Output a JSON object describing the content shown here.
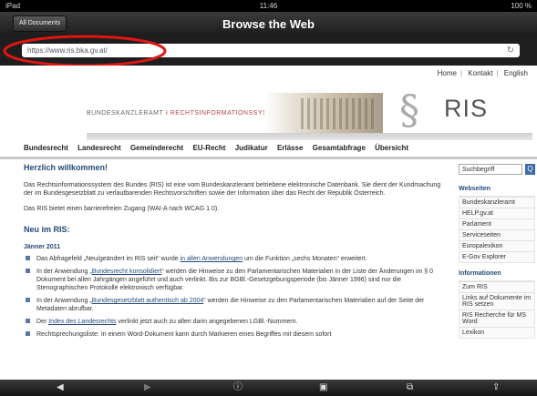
{
  "statusbar": {
    "left": "iPad",
    "time": "11:46",
    "battery": "100 %"
  },
  "navbar": {
    "back_label": "All Documents",
    "title": "Browse the Web"
  },
  "url": {
    "value": "https://www.ris.bka.gv.at/"
  },
  "top_links": [
    "Home",
    "Kontakt",
    "English"
  ],
  "banner": {
    "left_text": "BUNDESKANZLERAMT",
    "right_text": "RECHTSINFORMATIONSSYSTEM",
    "logo": "RIS",
    "symbol": "§"
  },
  "main_nav": [
    "Bundesrecht",
    "Landesrecht",
    "Gemeinderecht",
    "EU-Recht",
    "Judikatur",
    "Erlässe",
    "Gesamtabfrage",
    "Übersicht"
  ],
  "content": {
    "welcome_title": "Herzlich willkommen!",
    "welcome_p1": "Das Rechtsinformationssystem des Bundes (RIS) ist eine vom Bundeskanzleramt betriebene elektronische Datenbank. Sie dient der Kundmachung der im Bundesgesetzblatt zu verlautbarenden Rechtsvorschriften sowie der Information über das Recht der Republik Österreich.",
    "welcome_p2": "Das RIS bietet einen barrierefreien Zugang (WAI-A nach WCAG 1.0).",
    "news_title": "Neu im RIS:",
    "news_date": "Jänner 2011",
    "news": [
      {
        "text": "Das Abfragefeld „Neu/geändert im RIS seit“ wurde ",
        "link": "in allen Anwendungen",
        "rest": " um die Funktion „sechs Monaten“ erweitert."
      },
      {
        "text": "In der Anwendung „",
        "link": "Bundesrecht konsolidiert",
        "rest": "“ werden die Hinweise zu den Parlamentarischen Materialien in der Liste der Änderungen im § 0 Dokument bei allen Jahrgängen angeführt und auch verlinkt. Bis zur BGBl.-Gesetzgebungsperiode (bis Jänner 1996) sind nur die Stenographischen Protokolle elektronisch verfügbar."
      },
      {
        "text": "In der Anwendung „",
        "link": "Bundesgesetzblatt authentisch ab 2004",
        "rest": "“ werden die Hinweise zu den Parlamentarischen Materialien auf der Seite der Metadaten abrufbar."
      },
      {
        "text": "Der ",
        "link": "Index des Landesrechts",
        "rest": " verlinkt jetzt auch zu allen darin angegebenen LGBl.-Nummern."
      },
      {
        "text": "Rechtsprechungsliste: In einem Word-Dokument kann durch Markieren eines Begriffes mit diesem sofort",
        "link": "",
        "rest": ""
      }
    ]
  },
  "sidebar": {
    "search_placeholder": "Suchbegriff",
    "search_button": "Q",
    "websites_title": "Webseiten",
    "websites": [
      "Bundeskanzleramt",
      "HELP.gv.at",
      "Parlament",
      "Serviceseiten",
      "Europalexikon",
      "E-Gov Explorer"
    ],
    "info_title": "Informationen",
    "info": [
      "Zum RIS",
      "Links auf Dokumente im RIS setzen",
      "RIS Recherche für MS Word",
      "Lexikon"
    ]
  },
  "toolbar": {
    "icons": [
      "back-icon",
      "forward-icon",
      "info-icon",
      "save-icon",
      "open-icon",
      "share-icon"
    ]
  },
  "colors": {
    "annotation": "#e01515",
    "link": "#234a7a",
    "ris_red": "#c21d1d"
  }
}
